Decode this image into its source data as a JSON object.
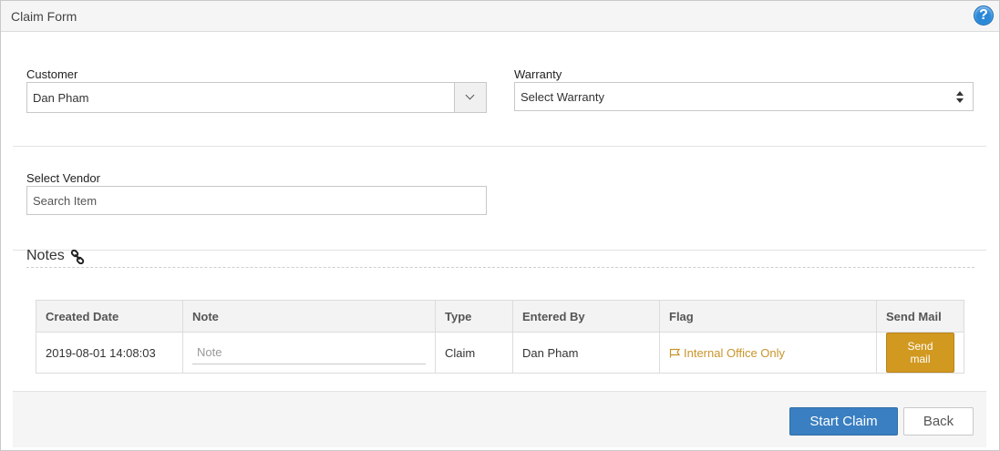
{
  "header": {
    "title": "Claim Form",
    "help_icon": "help-icon",
    "help_glyph": "?"
  },
  "customer": {
    "label": "Customer",
    "value": "Dan Pham",
    "dropdown_icon": "chevron-down-icon"
  },
  "warranty": {
    "label": "Warranty",
    "value": "Select Warranty",
    "dropdown_icon": "up-down-arrows-icon"
  },
  "vendor": {
    "label": "Select Vendor",
    "placeholder": "Search Item"
  },
  "notes": {
    "title": "Notes",
    "title_icon": "link-icon",
    "columns": [
      "Created Date",
      "Note",
      "Type",
      "Entered By",
      "Flag",
      "Send Mail"
    ],
    "rows": [
      {
        "created_date": "2019-08-01 14:08:03",
        "note_placeholder": "Note",
        "type": "Claim",
        "entered_by": "Dan Pham",
        "flag_icon": "flag-icon",
        "flag": "Internal Office Only",
        "send_mail_label": "Send mail"
      }
    ]
  },
  "footer": {
    "start_claim_label": "Start Claim",
    "back_label": "Back"
  },
  "colors": {
    "primary": "#3a7fc1",
    "warning": "#d19920",
    "flag_text": "#c9952b",
    "help_icon": "#2b88d8"
  }
}
